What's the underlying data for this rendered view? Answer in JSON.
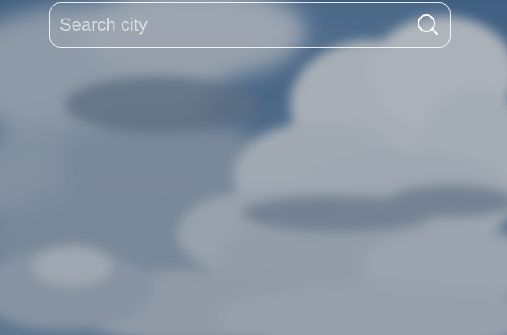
{
  "search": {
    "placeholder": "Search city",
    "value": "",
    "button_icon": "search-icon"
  },
  "background": {
    "type": "cloudy-sky-photo",
    "tint": "dark-overlay"
  },
  "colors": {
    "sky": "#5a7fa6",
    "cloud": "#dde4ec",
    "border": "#ffffff"
  }
}
